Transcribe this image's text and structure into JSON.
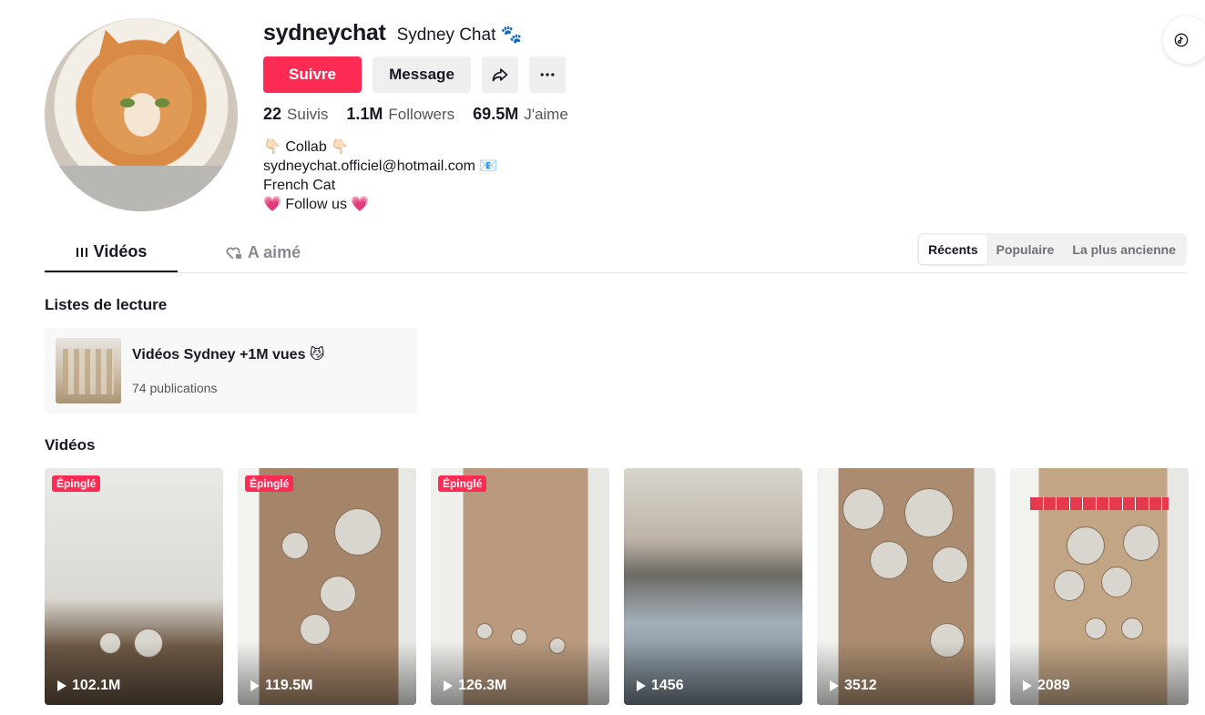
{
  "profile": {
    "username": "sydneychat",
    "nickname": "Sydney Chat 🐾",
    "follow_label": "Suivre",
    "message_label": "Message",
    "stats": [
      {
        "value": "22",
        "label": "Suivis"
      },
      {
        "value": "1.1M",
        "label": "Followers"
      },
      {
        "value": "69.5M",
        "label": "J'aime"
      }
    ],
    "bio": [
      "👇🏻 Collab 👇🏻",
      "sydneychat.officiel@hotmail.com 📧",
      "French Cat",
      "💗 Follow us 💗"
    ]
  },
  "tabs": [
    {
      "label": "Vidéos",
      "icon": "grid-icon",
      "active": true
    },
    {
      "label": "A aimé",
      "icon": "heart-lock-icon",
      "active": false
    }
  ],
  "sort_options": [
    {
      "label": "Récents",
      "selected": true
    },
    {
      "label": "Populaire",
      "selected": false
    },
    {
      "label": "La plus ancienne",
      "selected": false
    }
  ],
  "playlists_title": "Listes de lecture",
  "playlist": {
    "title": "Vidéos Sydney +1M vues 😼",
    "count": "74 publications"
  },
  "videos_title": "Vidéos",
  "pin_label": "Épinglé",
  "videos": [
    {
      "views": "102.1M",
      "pinned": true
    },
    {
      "views": "119.5M",
      "pinned": true
    },
    {
      "views": "126.3M",
      "pinned": true
    },
    {
      "views": "1456",
      "pinned": false
    },
    {
      "views": "3512",
      "pinned": false
    },
    {
      "views": "2089",
      "pinned": false
    }
  ],
  "colors": {
    "accent": "#fe2c55",
    "text": "#161823",
    "muted": "#8a8b91"
  }
}
